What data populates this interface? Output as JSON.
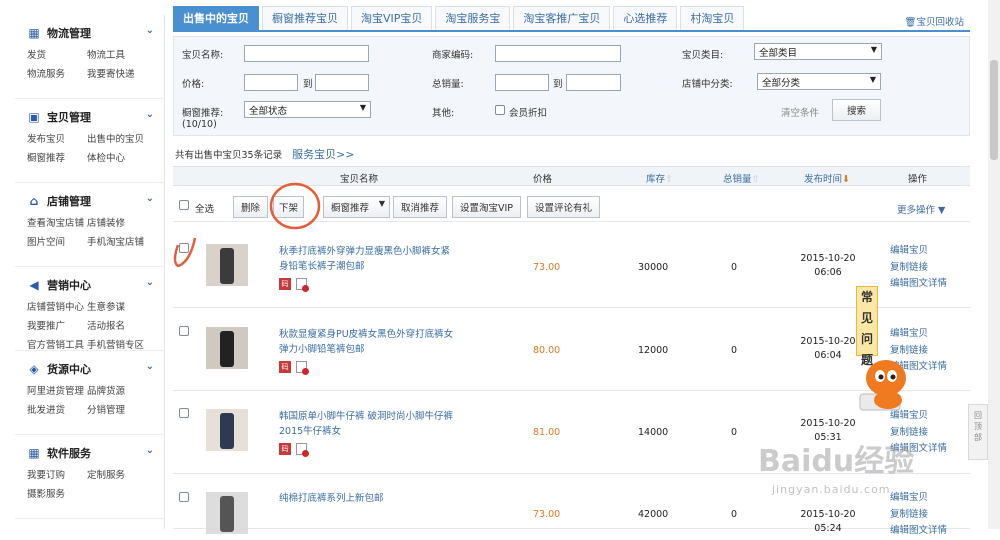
{
  "sidebar": {
    "sections": [
      {
        "title": "物流管理",
        "icon": "truck-icon",
        "links": [
          "发货",
          "物流工具",
          "物流服务",
          "我要寄快递"
        ]
      },
      {
        "title": "宝贝管理",
        "icon": "bag-icon",
        "links": [
          "发布宝贝",
          "出售中的宝贝",
          "橱窗推荐",
          "体检中心"
        ]
      },
      {
        "title": "店铺管理",
        "icon": "shop-icon",
        "links": [
          "查看淘宝店铺",
          "店铺装修",
          "图片空间",
          "手机淘宝店铺"
        ]
      },
      {
        "title": "营销中心",
        "icon": "megaphone-icon",
        "links": [
          "店铺营销中心",
          "生意参谋",
          "我要推广",
          "活动报名",
          "官方营销工具",
          "手机营销专区"
        ]
      },
      {
        "title": "货源中心",
        "icon": "box-icon",
        "links": [
          "阿里进货管理",
          "品牌货源",
          "批发进货",
          "分销管理"
        ]
      },
      {
        "title": "软件服务",
        "icon": "grid-icon",
        "links": [
          "我要订购",
          "定制服务",
          "摄影服务"
        ]
      }
    ]
  },
  "tabs": [
    "出售中的宝贝",
    "橱窗推荐宝贝",
    "淘宝VIP宝贝",
    "淘宝服务宝",
    "淘宝客推广宝贝",
    "心选推荐",
    "村淘宝贝"
  ],
  "recycle_label": "宝贝回收站",
  "filter": {
    "name_label": "宝贝名称:",
    "code_label": "商家编码:",
    "category_label": "宝贝类目:",
    "category_value": "全部类目",
    "price_label": "价格:",
    "to_label": "到",
    "sales_label": "总销量:",
    "shop_category_label": "店铺中分类:",
    "shop_category_value": "全部分类",
    "window_label": "橱窗推荐:",
    "window_count": "(10/10)",
    "window_value": "全部状态",
    "other_label": "其他:",
    "member_discount": "会员折扣",
    "clear_label": "清空条件",
    "search_label": "搜索"
  },
  "summary": {
    "text": "共有出售中宝贝35条记录",
    "link": "服务宝贝>>"
  },
  "table": {
    "headers": [
      "宝贝名称",
      "价格",
      "库存",
      "总销量",
      "发布时间",
      "操作"
    ],
    "select_all": "全选",
    "actions": [
      "删除",
      "下架",
      "橱窗推荐",
      "取消推荐",
      "设置淘宝VIP",
      "设置评论有礼"
    ],
    "more_ops": "更多操作",
    "rows": [
      {
        "title": "秋季打底裤外穿弹力显瘦黑色小脚裤女紧身铅笔长裤子潮包邮",
        "price": "73.00",
        "stock": "30000",
        "sales": "0",
        "date": "2015-10-20",
        "time": "06:06"
      },
      {
        "title": "秋款显瘦紧身PU皮裤女黑色外穿打底裤女弹力小脚铅笔裤包邮",
        "price": "80.00",
        "stock": "12000",
        "sales": "0",
        "date": "2015-10-20",
        "time": "06:04"
      },
      {
        "title": "韩国原单小脚牛仔裤 破洞时尚小脚牛仔裤2015牛仔裤女",
        "price": "81.00",
        "stock": "14000",
        "sales": "0",
        "date": "2015-10-20",
        "time": "05:31"
      },
      {
        "title": "纯棉打底裤系列上新包邮",
        "price": "73.00",
        "stock": "42000",
        "sales": "0",
        "date": "2015-10-20",
        "time": "05:24"
      }
    ],
    "row_ops": [
      "编辑宝贝",
      "复制链接",
      "编辑图文详情"
    ],
    "badge_text": "码"
  },
  "faq": "常见问题",
  "backtop": "回顶部",
  "watermark": "Baidu经验",
  "watermark_url": "jingyan.baidu.com"
}
